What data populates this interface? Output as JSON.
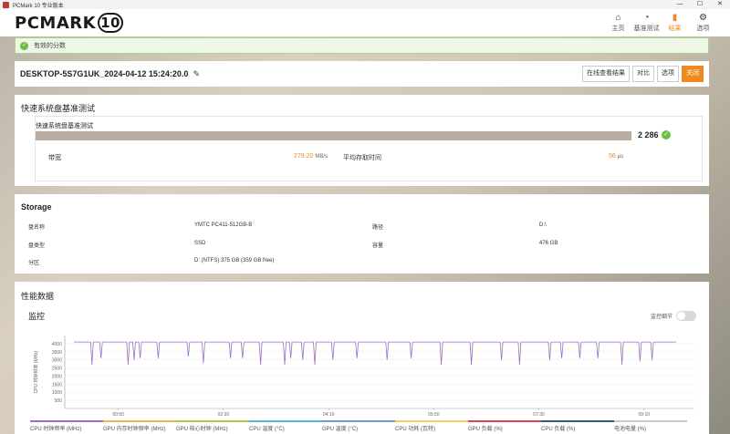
{
  "window": {
    "title": "PCMark 10 专业版本",
    "controls": [
      "—",
      "☐",
      "✕"
    ]
  },
  "header": {
    "logo_text": "PCMARK",
    "logo_number": "10"
  },
  "nav": [
    {
      "label": "主页",
      "icon": "home-icon",
      "glyph": "⌂"
    },
    {
      "label": "基准测试",
      "icon": "gauge-icon",
      "glyph": "◔"
    },
    {
      "label": "结果",
      "icon": "bar-chart-icon",
      "glyph": "▮"
    },
    {
      "label": "选项",
      "icon": "gear-icon",
      "glyph": "⚙"
    }
  ],
  "notice": {
    "text": "有效的分数",
    "icon": "check-circle-icon"
  },
  "result": {
    "name": "DESKTOP-5S7G1UK_2024-04-12 15:24:20.0",
    "buttons": [
      "在线查看结果",
      "对比",
      "选项",
      "关闭"
    ]
  },
  "quick_test": {
    "title": "快速系统盘基准测试",
    "subtitle": "快速系统盘基准测试",
    "score": "2 286",
    "bandwidth_label": "带宽",
    "bandwidth_value": "279.20",
    "bandwidth_unit": "MB/s",
    "access_label": "平均存取时间",
    "access_value": "56",
    "access_unit": "μs"
  },
  "storage": {
    "title": "Storage",
    "rows": [
      {
        "k1": "盘名称",
        "v1": "YMTC PC411-512GB-B",
        "k2": "路径",
        "v2": "D:\\"
      },
      {
        "k1": "盘类型",
        "v1": "SSD",
        "k2": "容量",
        "v2": "476 GB"
      },
      {
        "k1": "分区",
        "v1": "D: (NTFS) 375 GB (359 GB free)",
        "k2": "",
        "v2": ""
      }
    ]
  },
  "performance": {
    "title": "性能数据",
    "monitor_title": "监控",
    "toggle_label": "监控细节",
    "legend": [
      {
        "label": "CPU 时钟频率 (MHz)",
        "color": "#9b6fc4"
      },
      {
        "label": "GPU 内存时钟频率 (MHz)",
        "color": "#f0b356"
      },
      {
        "label": "GPU 核心时钟 (MHz)",
        "color": "#a7c94a"
      },
      {
        "label": "CPU 温度 (°C)",
        "color": "#5ab4d6"
      },
      {
        "label": "GPU 温度 (°C)",
        "color": "#6e9ec8"
      },
      {
        "label": "CPU 功耗 (瓦特)",
        "color": "#f4d25a"
      },
      {
        "label": "GPU 负载 (%)",
        "color": "#d9455f"
      },
      {
        "label": "CPU 负载 (%)",
        "color": "#2e5c7a"
      },
      {
        "label": "电池电量 (%)",
        "color": "#c9c9c9"
      }
    ]
  },
  "chart_data": {
    "type": "line",
    "ylabel": "CPU 时钟频率 (MHz)",
    "yticks": [
      500,
      1000,
      1500,
      2000,
      2500,
      3000,
      3500,
      4000
    ],
    "ylim": [
      0,
      4500
    ],
    "xticks": [
      "00:50",
      "02:30",
      "04:10",
      "05:50",
      "07:30",
      "09:10"
    ],
    "series": [
      {
        "name": "CPU 时钟频率 (MHz)",
        "color": "#9b6fc4",
        "baseline": 4100,
        "dips": [
          [
            0.03,
            2700
          ],
          [
            0.045,
            3100
          ],
          [
            0.09,
            2700
          ],
          [
            0.1,
            3000
          ],
          [
            0.11,
            3100
          ],
          [
            0.14,
            3100
          ],
          [
            0.19,
            3200
          ],
          [
            0.215,
            2800
          ],
          [
            0.26,
            3100
          ],
          [
            0.28,
            3100
          ],
          [
            0.31,
            2700
          ],
          [
            0.35,
            2700
          ],
          [
            0.36,
            3100
          ],
          [
            0.38,
            3000
          ],
          [
            0.4,
            2700
          ],
          [
            0.43,
            3000
          ],
          [
            0.47,
            3100
          ],
          [
            0.52,
            3000
          ],
          [
            0.56,
            3100
          ],
          [
            0.61,
            2700
          ],
          [
            0.66,
            2700
          ],
          [
            0.71,
            3000
          ],
          [
            0.74,
            2700
          ],
          [
            0.79,
            3000
          ],
          [
            0.81,
            3100
          ],
          [
            0.84,
            3100
          ],
          [
            0.87,
            3100
          ],
          [
            0.91,
            2700
          ],
          [
            0.94,
            2900
          ],
          [
            0.96,
            3000
          ]
        ]
      }
    ]
  }
}
